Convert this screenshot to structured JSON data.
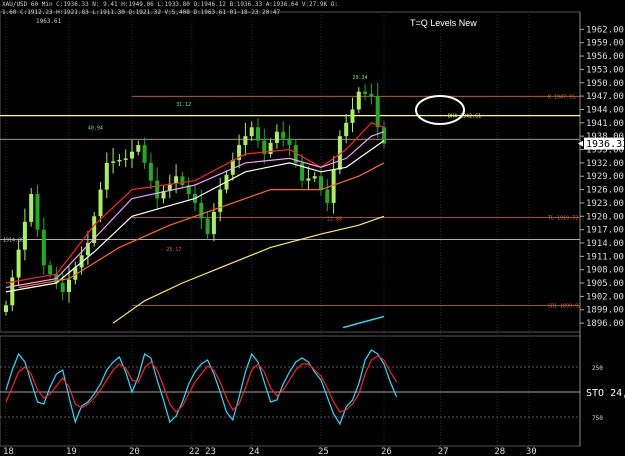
{
  "header": {
    "line1": "XAU/USD 60 Min   C:1936.33   N:  9.41  H:1949.06  L:1933.80  O:1946.12  B:1936.33  A:1936.64  V:27.9K  O:",
    "line2": "1.60  C:1912.23  H:1921.83  L:1911.30  O:1921.32  V:5,408  D:1963.61  01-18-23  20:47",
    "high_label": "1963.61"
  },
  "title": "T=Q Levels New",
  "colors": {
    "background": "#000000",
    "bull_candle": "#a8f060",
    "bear_candle": "#22aa22",
    "yellow_level": "#ffff66",
    "orange_level": "#d07020",
    "white_level": "#c8c8c8",
    "ma_red": "#ff2020",
    "ma_pink": "#ff99ff",
    "ma_white": "#ffffff",
    "ma_orange": "#ff6a1a",
    "ma_yellow": "#ffee55",
    "stoch_cyan": "#22e0ff",
    "stoch_red": "#ff2222"
  },
  "chart_data": [
    {
      "type": "candlestick",
      "symbol": "XAU/USD",
      "timeframe": "60 Min",
      "title": "T=Q Levels New",
      "ylim": [
        1894,
        1965
      ],
      "y_ticks": [
        "1962.00",
        "1959.00",
        "1956.00",
        "1953.00",
        "1950.00",
        "1947.00",
        "1944.00",
        "1941.00",
        "1938.00",
        "1935.00",
        "1932.00",
        "1929.00",
        "1926.00",
        "1923.00",
        "1920.00",
        "1917.00",
        "1914.00",
        "1911.00",
        "1908.00",
        "1905.00",
        "1902.00",
        "1899.00",
        "1896.00"
      ],
      "y_tick_values": [
        1962,
        1959,
        1956,
        1953,
        1950,
        1947,
        1944,
        1941,
        1938,
        1935,
        1932,
        1929,
        1926,
        1923,
        1920,
        1917,
        1914,
        1911,
        1908,
        1905,
        1902,
        1899,
        1896
      ],
      "last_price": "1936.33",
      "last_price_value": 1936.33,
      "x_ticks": [
        "18",
        "19",
        "20",
        "22 23",
        "24",
        "25",
        "26",
        "27",
        "28",
        "30"
      ],
      "x_tick_bars": [
        0,
        10,
        20,
        29.5,
        39,
        50,
        60,
        69,
        78,
        83
      ],
      "num_bars": 86,
      "bar_count_visible": 62,
      "key_points": [
        {
          "bar": 0,
          "value": 1900
        },
        {
          "bar": 4,
          "value": 1925
        },
        {
          "bar": 6,
          "value": 1909
        },
        {
          "bar": 9,
          "value": 1903
        },
        {
          "bar": 13,
          "value": 1914
        },
        {
          "bar": 16,
          "value": 1932
        },
        {
          "bar": 19,
          "value": 1933
        },
        {
          "bar": 21,
          "value": 1936
        },
        {
          "bar": 24,
          "value": 1924
        },
        {
          "bar": 27,
          "value": 1929
        },
        {
          "bar": 30,
          "value": 1923
        },
        {
          "bar": 32,
          "value": 1916
        },
        {
          "bar": 34,
          "value": 1926
        },
        {
          "bar": 37,
          "value": 1936
        },
        {
          "bar": 39,
          "value": 1940
        },
        {
          "bar": 41,
          "value": 1934
        },
        {
          "bar": 43,
          "value": 1939
        },
        {
          "bar": 45,
          "value": 1936
        },
        {
          "bar": 47,
          "value": 1928
        },
        {
          "bar": 49,
          "value": 1929
        },
        {
          "bar": 51,
          "value": 1923
        },
        {
          "bar": 53,
          "value": 1938
        },
        {
          "bar": 55,
          "value": 1944
        },
        {
          "bar": 56,
          "value": 1948
        },
        {
          "bar": 58,
          "value": 1947
        },
        {
          "bar": 59,
          "value": 1940
        },
        {
          "bar": 60,
          "value": 1936.33
        }
      ],
      "levels": [
        {
          "price": 1946.95,
          "label": "R 1947.95",
          "color": "orange"
        },
        {
          "price": 1942.61,
          "label": "DH4 1942.61",
          "color": "yellow"
        },
        {
          "price": 1937.3,
          "label": "",
          "color": "white"
        },
        {
          "price": 1919.72,
          "label": "TL 1919.72",
          "color": "orange"
        },
        {
          "price": 1914.8,
          "label": "1914.80",
          "color": "white"
        },
        {
          "price": 1899.92,
          "label": "SR1 1899.92",
          "color": "orange"
        }
      ],
      "annotations": [
        {
          "text": "40.94",
          "bar": 13,
          "value": 1939.5,
          "color": "green"
        },
        {
          "text": "31.12",
          "bar": 27,
          "value": 1944.8,
          "color": "green"
        },
        {
          "text": "29.34",
          "bar": 55,
          "value": 1950.8,
          "color": "green"
        },
        {
          "text": "- 25.17",
          "bar": 24.5,
          "value": 1912.2,
          "color": "orange"
        },
        {
          "text": "- 22.88",
          "bar": 50,
          "value": 1919,
          "color": "orange"
        }
      ],
      "moving_averages": [
        {
          "color": "red",
          "points": [
            [
              0,
              1905
            ],
            [
              8,
              1907
            ],
            [
              14,
              1918
            ],
            [
              20,
              1926
            ],
            [
              30,
              1928
            ],
            [
              38,
              1934
            ],
            [
              45,
              1935
            ],
            [
              50,
              1931
            ],
            [
              54,
              1935
            ],
            [
              58,
              1941
            ],
            [
              60,
              1940
            ]
          ]
        },
        {
          "color": "pink",
          "points": [
            [
              0,
              1904
            ],
            [
              8,
              1906
            ],
            [
              14,
              1915
            ],
            [
              20,
              1924
            ],
            [
              30,
              1927
            ],
            [
              38,
              1932
            ],
            [
              45,
              1933
            ],
            [
              50,
              1931
            ],
            [
              54,
              1933
            ],
            [
              58,
              1938
            ],
            [
              60,
              1939
            ]
          ]
        },
        {
          "color": "white",
          "points": [
            [
              0,
              1903
            ],
            [
              8,
              1905
            ],
            [
              14,
              1912
            ],
            [
              20,
              1920
            ],
            [
              30,
              1924
            ],
            [
              38,
              1930
            ],
            [
              45,
              1932
            ],
            [
              50,
              1930
            ],
            [
              54,
              1931
            ],
            [
              58,
              1935
            ],
            [
              60,
              1937
            ]
          ]
        },
        {
          "color": "orange",
          "points": [
            [
              2,
              1904
            ],
            [
              10,
              1906
            ],
            [
              18,
              1913
            ],
            [
              26,
              1918
            ],
            [
              34,
              1922
            ],
            [
              42,
              1926
            ],
            [
              50,
              1926
            ],
            [
              56,
              1929
            ],
            [
              60,
              1932
            ]
          ]
        },
        {
          "color": "yellow",
          "points": [
            [
              17,
              1896
            ],
            [
              22,
              1901
            ],
            [
              28,
              1905
            ],
            [
              35,
              1909
            ],
            [
              42,
              1913
            ],
            [
              50,
              1916
            ],
            [
              56,
              1918
            ],
            [
              60,
              1920
            ]
          ]
        }
      ],
      "cyan_segment": [
        [
          53.5,
          1895
        ],
        [
          60,
          1897.5
        ]
      ]
    },
    {
      "type": "line",
      "name": "STO",
      "label": "STO 24,",
      "ylim": [
        0,
        100
      ],
      "y_ticks": [
        "250",
        "750"
      ],
      "y_tick_values": [
        75,
        25
      ],
      "series": [
        {
          "color": "cyan",
          "values": [
            52,
            72,
            88,
            80,
            60,
            40,
            38,
            55,
            68,
            72,
            45,
            20,
            36,
            40,
            48,
            58,
            72,
            80,
            85,
            70,
            50,
            65,
            88,
            84,
            62,
            42,
            20,
            26,
            40,
            58,
            70,
            78,
            82,
            68,
            50,
            30,
            22,
            45,
            70,
            88,
            80,
            60,
            40,
            42,
            58,
            70,
            80,
            84,
            80,
            70,
            62,
            45,
            28,
            18,
            35,
            42,
            58,
            82,
            92,
            88,
            78,
            60,
            45
          ]
        },
        {
          "color": "red",
          "values": [
            40,
            55,
            70,
            75,
            68,
            52,
            44,
            48,
            56,
            64,
            55,
            38,
            34,
            38,
            44,
            52,
            62,
            72,
            78,
            74,
            62,
            60,
            74,
            80,
            72,
            56,
            38,
            30,
            36,
            48,
            60,
            68,
            76,
            72,
            60,
            44,
            32,
            38,
            54,
            72,
            78,
            70,
            54,
            46,
            52,
            62,
            72,
            78,
            78,
            72,
            66,
            54,
            40,
            30,
            32,
            38,
            48,
            68,
            82,
            86,
            82,
            70,
            60
          ]
        }
      ]
    }
  ]
}
